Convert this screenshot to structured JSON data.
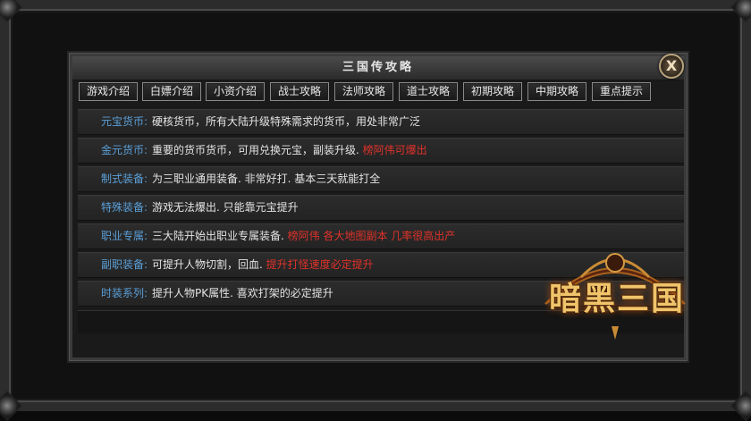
{
  "window": {
    "title": "三国传攻略",
    "close_glyph": "X"
  },
  "tabs": [
    {
      "label": "游戏介绍"
    },
    {
      "label": "白嫖介绍"
    },
    {
      "label": "小资介绍"
    },
    {
      "label": "战士攻略"
    },
    {
      "label": "法师攻略"
    },
    {
      "label": "道士攻略"
    },
    {
      "label": "初期攻略"
    },
    {
      "label": "中期攻略"
    },
    {
      "label": "重点提示"
    }
  ],
  "rows": [
    {
      "label": "元宝货币:",
      "text": "硬核货币，所有大陆升级特殊需求的货币，用处非常广泛",
      "highlight": ""
    },
    {
      "label": "金元货币:",
      "text": "重要的货币货币，可用兑换元宝，副装升级.",
      "highlight": "榜阿伟可爆出"
    },
    {
      "label": "制式装备:",
      "text": "为三职业通用装备. 非常好打. 基本三天就能打全",
      "highlight": ""
    },
    {
      "label": "特殊装备:",
      "text": "游戏无法爆出. 只能靠元宝提升",
      "highlight": ""
    },
    {
      "label": "职业专属:",
      "text": "三大陆开始出职业专属装备.",
      "highlight": "榜阿伟  各大地图副本  几率很高出产"
    },
    {
      "label": "副职装备:",
      "text": "可提升人物切割，回血.",
      "highlight": "提升打怪速度必定提升"
    },
    {
      "label": "时装系列:",
      "text": "提升人物PK属性. 喜欢打架的必定提升",
      "highlight": ""
    }
  ],
  "logo": {
    "text": "暗黑三国"
  },
  "colors": {
    "label_blue": "#5a9fd8",
    "highlight_red": "#e0322a",
    "text": "#e4e4e4"
  }
}
